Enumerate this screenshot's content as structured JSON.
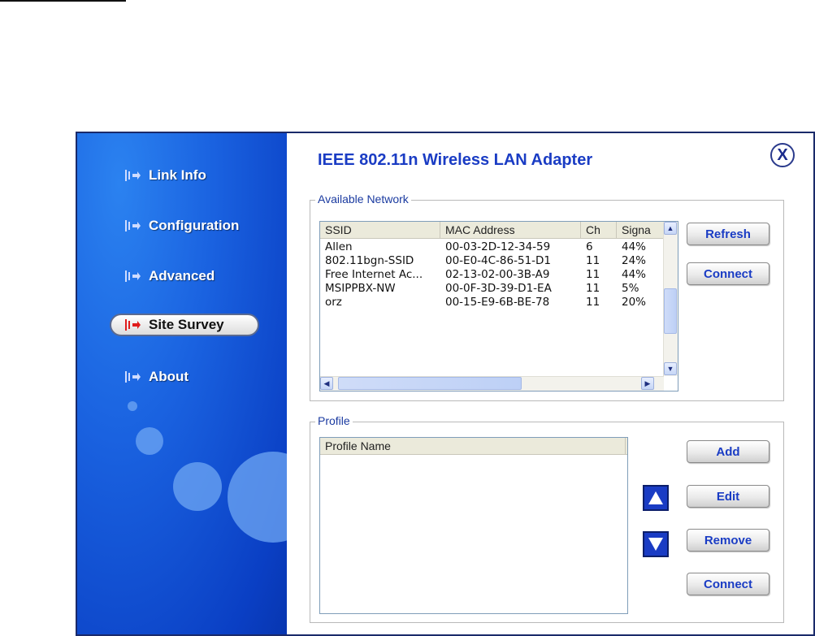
{
  "window": {
    "title": "IEEE 802.11n Wireless LAN Adapter",
    "close_symbol": "X"
  },
  "sidebar": {
    "items": [
      {
        "label": "Link Info",
        "active": false
      },
      {
        "label": "Configuration",
        "active": false
      },
      {
        "label": "Advanced",
        "active": false
      },
      {
        "label": "Site Survey",
        "active": true
      },
      {
        "label": "About",
        "active": false
      }
    ]
  },
  "available_network": {
    "legend": "Available Network",
    "columns": [
      "SSID",
      "MAC Address",
      "Ch",
      "Signa"
    ],
    "rows": [
      [
        "Allen",
        "00-03-2D-12-34-59",
        "6",
        "44%"
      ],
      [
        "802.11bgn-SSID",
        "00-E0-4C-86-51-D1",
        "11",
        "24%"
      ],
      [
        "Free Internet Ac...",
        "02-13-02-00-3B-A9",
        "11",
        "44%"
      ],
      [
        "MSIPPBX-NW",
        "00-0F-3D-39-D1-EA",
        "11",
        "5%"
      ],
      [
        "orz",
        "00-15-E9-6B-BE-78",
        "11",
        "20%"
      ]
    ],
    "buttons": {
      "refresh": "Refresh",
      "connect": "Connect"
    }
  },
  "profile": {
    "legend": "Profile",
    "column": "Profile Name",
    "buttons": {
      "add": "Add",
      "edit": "Edit",
      "remove": "Remove",
      "connect": "Connect"
    }
  },
  "colors": {
    "accent": "#1a3cc4",
    "sidebar": "#1a62e0",
    "legend": "#1a3aa0"
  }
}
